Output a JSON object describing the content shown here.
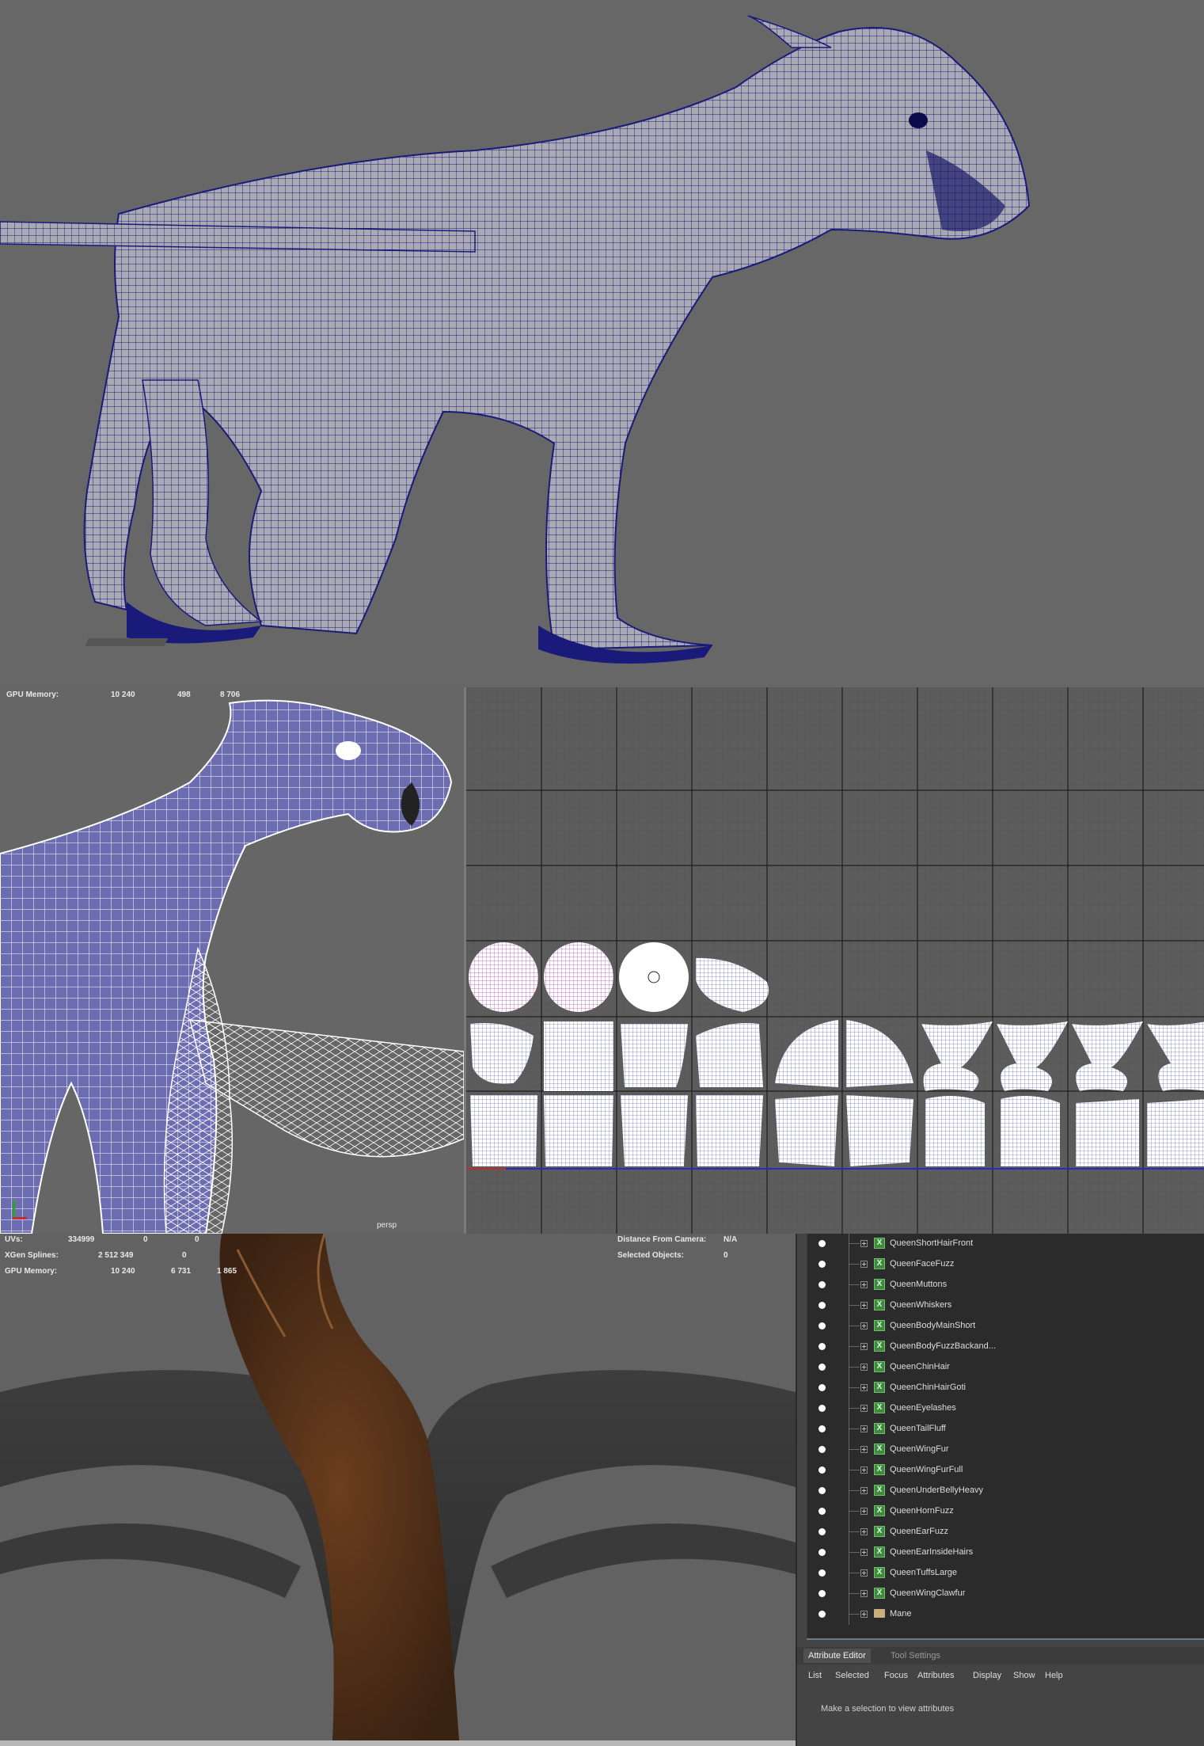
{
  "viewport_mid_hud": {
    "gpu_label": "GPU Memory:",
    "gpu_v1": "10 240",
    "gpu_v2": "498",
    "gpu_v3": "8 706",
    "camera": "persp"
  },
  "viewport_bottom_hud": {
    "uvs_label": "UVs:",
    "uvs_v1": "334999",
    "uvs_v2": "0",
    "uvs_v3": "0",
    "xgen_label": "XGen Splines:",
    "xgen_v1": "2 512 349",
    "xgen_v2": "0",
    "gpu_label": "GPU Memory:",
    "gpu_v1": "10 240",
    "gpu_v2": "6 731",
    "gpu_v3": "1 865",
    "distance_label": "Distance From Camera:",
    "distance_value": "N/A",
    "selected_label": "Selected Objects:",
    "selected_value": "0"
  },
  "outliner": {
    "items": [
      {
        "label": "QueenShortHairFront",
        "icon": "xgen-icon"
      },
      {
        "label": "QueenFaceFuzz",
        "icon": "xgen-icon"
      },
      {
        "label": "QueenMuttons",
        "icon": "xgen-icon"
      },
      {
        "label": "QueenWhiskers",
        "icon": "xgen-icon"
      },
      {
        "label": "QueenBodyMainShort",
        "icon": "xgen-icon"
      },
      {
        "label": "QueenBodyFuzzBackand...",
        "icon": "xgen-icon"
      },
      {
        "label": "QueenChinHair",
        "icon": "xgen-icon"
      },
      {
        "label": "QueenChinHairGoti",
        "icon": "xgen-icon"
      },
      {
        "label": "QueenEyelashes",
        "icon": "xgen-icon"
      },
      {
        "label": "QueenTailFluff",
        "icon": "xgen-icon"
      },
      {
        "label": "QueenWingFur",
        "icon": "xgen-icon"
      },
      {
        "label": "QueenWingFurFull",
        "icon": "xgen-icon"
      },
      {
        "label": "QueenUnderBellyHeavy",
        "icon": "xgen-icon"
      },
      {
        "label": "QueenHornFuzz",
        "icon": "xgen-icon"
      },
      {
        "label": "QueenEarFuzz",
        "icon": "xgen-icon"
      },
      {
        "label": "QueenEarInsideHairs",
        "icon": "xgen-icon"
      },
      {
        "label": "QueenTuffsLarge",
        "icon": "xgen-icon"
      },
      {
        "label": "QueenWingClawfur",
        "icon": "xgen-icon"
      },
      {
        "label": "Mane",
        "icon": "folder-icon"
      }
    ]
  },
  "attribute_editor": {
    "tab_active": "Attribute Editor",
    "tab_inactive": "Tool Settings",
    "menu": [
      "List",
      "Selected",
      "Focus",
      "Attributes",
      "Display",
      "Show",
      "Help"
    ],
    "empty_message": "Make a selection to view attributes"
  },
  "colors": {
    "wireframe": "#1a1a7a",
    "uv_shell": "#ffffff",
    "uv_shell_purple": "#b04cb4",
    "fur": "#5a3218"
  }
}
